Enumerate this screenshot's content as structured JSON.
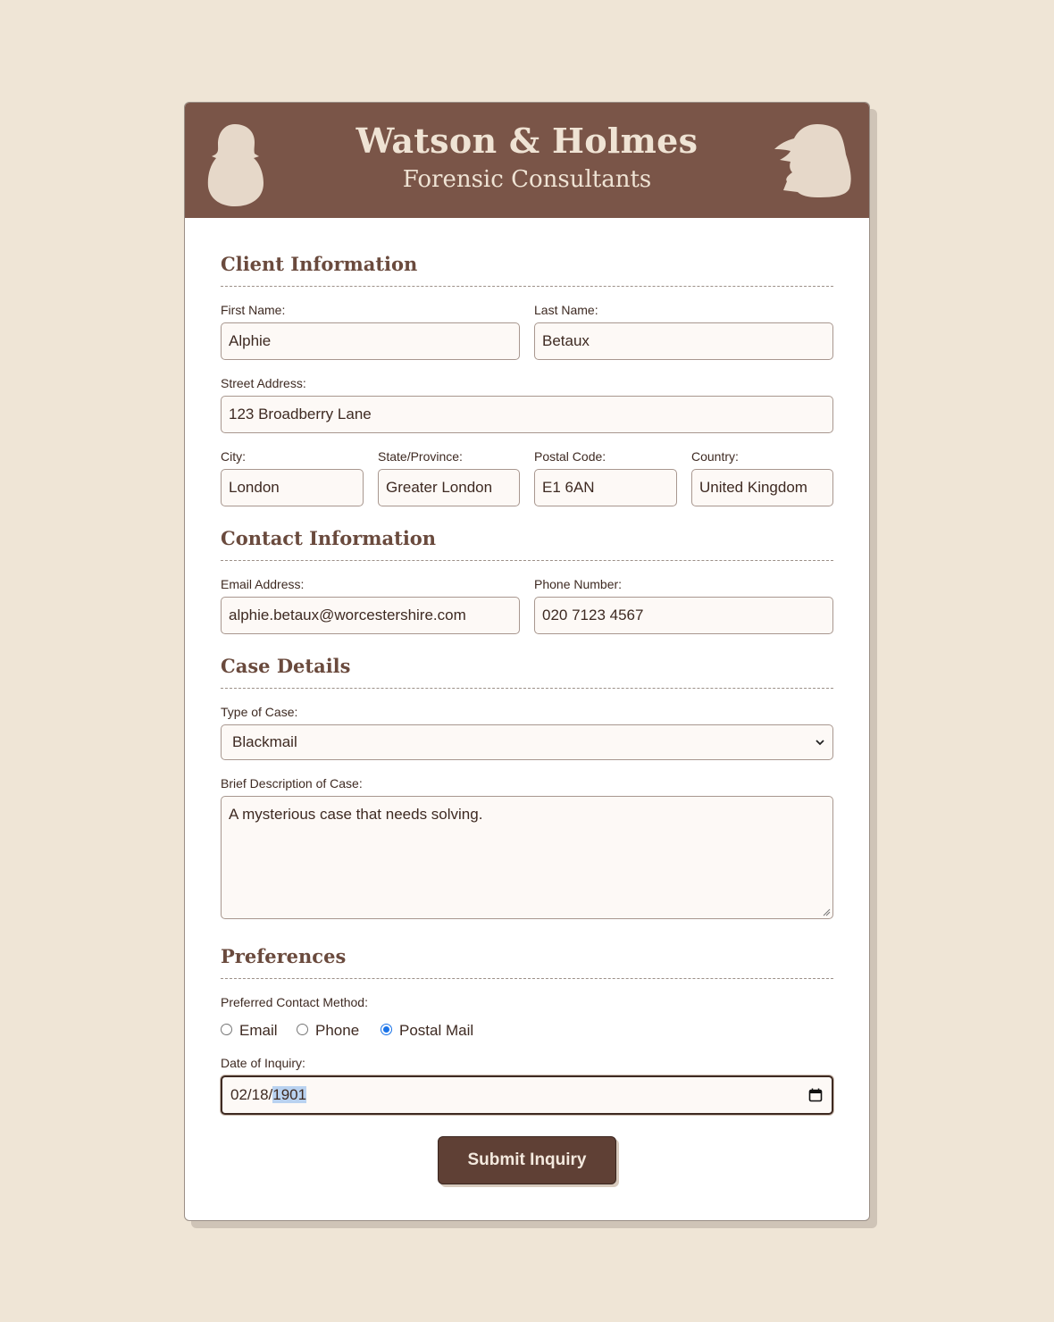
{
  "header": {
    "title": "Watson & Holmes",
    "subtitle": "Forensic Consultants"
  },
  "sections": {
    "client": "Client Information",
    "contact": "Contact Information",
    "case": "Case Details",
    "prefs": "Preferences"
  },
  "client": {
    "first_name_label": "First Name:",
    "first_name": "Alphie",
    "last_name_label": "Last Name:",
    "last_name": "Betaux",
    "street_label": "Street Address:",
    "street": "123 Broadberry Lane",
    "city_label": "City:",
    "city": "London",
    "state_label": "State/Province:",
    "state": "Greater London",
    "postal_label": "Postal Code:",
    "postal": "E1 6AN",
    "country_label": "Country:",
    "country": "United Kingdom"
  },
  "contact": {
    "email_label": "Email Address:",
    "email": "alphie.betaux@worcestershire.com",
    "phone_label": "Phone Number:",
    "phone": "020 7123 4567"
  },
  "case": {
    "type_label": "Type of Case:",
    "type_value": "Blackmail",
    "desc_label": "Brief Description of Case:",
    "desc": "A mysterious case that needs solving."
  },
  "prefs": {
    "method_label": "Preferred Contact Method:",
    "options": [
      "Email",
      "Phone",
      "Postal Mail"
    ],
    "selected": "Postal Mail",
    "date_label": "Date of Inquiry:",
    "date_prefix": "02/18/",
    "date_year": "1901"
  },
  "submit_label": "Submit Inquiry",
  "icons": {
    "left": "profile-silhouette-icon",
    "right": "profile-silhouette-icon",
    "select": "chevron-down-icon",
    "date": "calendar-icon"
  },
  "colors": {
    "page_bg": "#efe5d6",
    "header_bg": "#7a5548",
    "header_text": "#efe3d4",
    "button_bg": "#5f4035",
    "radio_accent": "#1a73e8"
  }
}
